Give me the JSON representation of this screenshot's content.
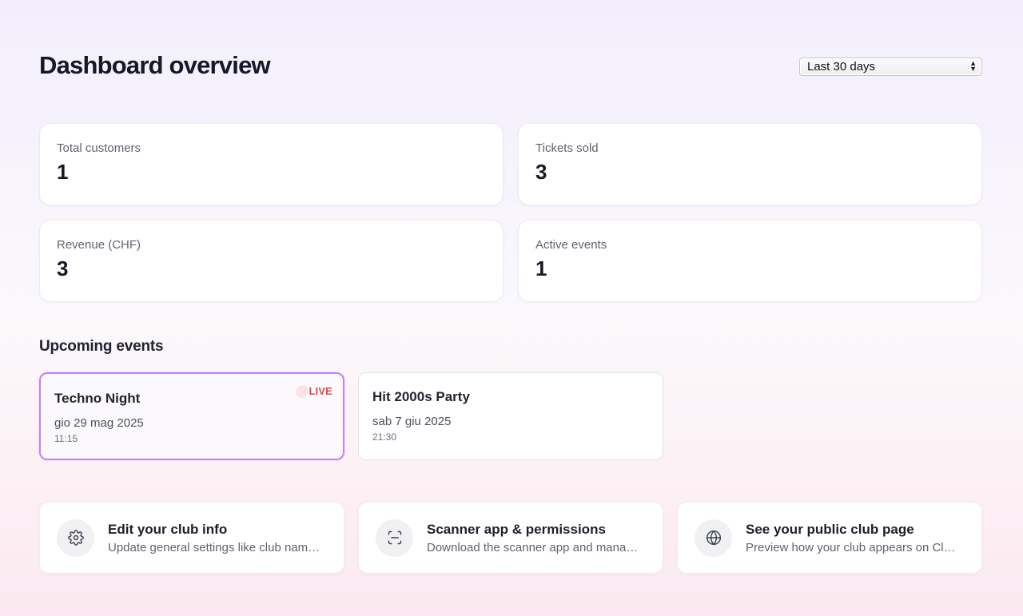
{
  "header": {
    "title": "Dashboard overview",
    "range_select": {
      "selected": "Last 30 days"
    }
  },
  "stats": [
    {
      "label": "Total customers",
      "value": "1"
    },
    {
      "label": "Tickets sold",
      "value": "3"
    },
    {
      "label": "Revenue (CHF)",
      "value": "3"
    },
    {
      "label": "Active events",
      "value": "1"
    }
  ],
  "upcoming": {
    "title": "Upcoming events",
    "events": [
      {
        "name": "Techno Night",
        "date": "gio 29 mag 2025",
        "time": "11:15",
        "badge": "LIVE"
      },
      {
        "name": "Hit 2000s Party",
        "date": "sab 7 giu 2025",
        "time": "21:30"
      }
    ]
  },
  "actions": [
    {
      "icon": "gear-icon",
      "title": "Edit your club info",
      "desc": "Update general settings like club name and details"
    },
    {
      "icon": "scan-icon",
      "title": "Scanner app & permissions",
      "desc": "Download the scanner app and manage permissions"
    },
    {
      "icon": "globe-icon",
      "title": "See your public club page",
      "desc": "Preview how your club appears on Clubs"
    }
  ],
  "colors": {
    "live_border": "#c084f5",
    "live_badge": "#e0443c"
  }
}
